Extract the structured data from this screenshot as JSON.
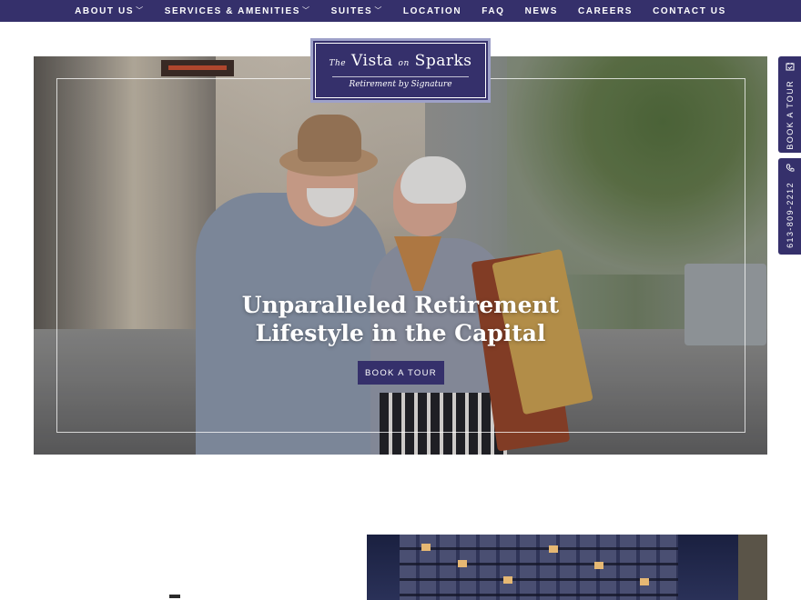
{
  "nav": {
    "items": [
      {
        "label": "ABOUT US",
        "has_dropdown": true
      },
      {
        "label": "SERVICES & AMENITIES",
        "has_dropdown": true
      },
      {
        "label": "SUITES",
        "has_dropdown": true
      },
      {
        "label": "LOCATION",
        "has_dropdown": false
      },
      {
        "label": "FAQ",
        "has_dropdown": false
      },
      {
        "label": "NEWS",
        "has_dropdown": false
      },
      {
        "label": "CAREERS",
        "has_dropdown": false
      },
      {
        "label": "CONTACT US",
        "has_dropdown": false
      }
    ],
    "chevron": "﹀"
  },
  "logo": {
    "the": "The",
    "vista": "Vista",
    "on": "on",
    "sparks": "Sparks",
    "tagline": "Retirement by Signature"
  },
  "hero": {
    "title": "Unparalleled Retirement\nLifestyle in the Capital",
    "cta_label": "BOOK A TOUR"
  },
  "side_tabs": {
    "tour_label": "BOOK A TOUR",
    "tour_icon": "calendar-check-icon",
    "phone_label": "613-809-2212",
    "phone_icon": "phone-icon"
  },
  "colors": {
    "brand": "#35306b",
    "logo_border": "#9ea1c9"
  }
}
